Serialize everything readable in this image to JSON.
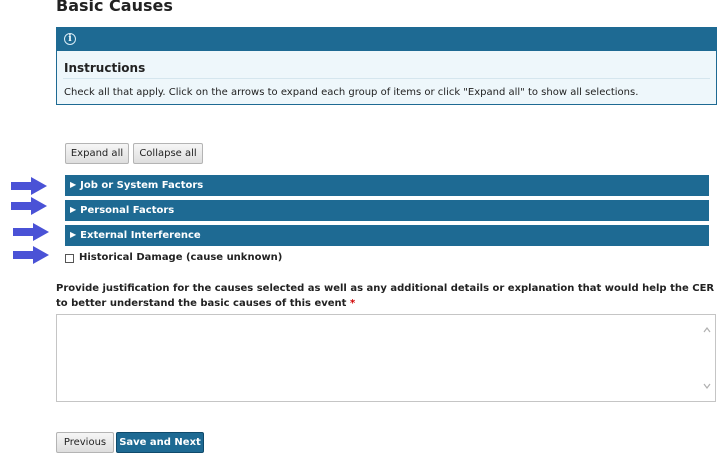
{
  "page": {
    "title": "Basic Causes"
  },
  "instructions": {
    "icon": "info-icon",
    "heading": "Instructions",
    "text": "Check all that apply. Click on the arrows to expand each group of items or click \"Expand all\" to show all selections."
  },
  "toolbar": {
    "expand_all": "Expand all",
    "collapse_all": "Collapse all"
  },
  "groups": [
    {
      "label": "Job or System Factors",
      "icon": "triangle-right-icon"
    },
    {
      "label": "Personal Factors",
      "icon": "triangle-right-icon"
    },
    {
      "label": "External Interference",
      "icon": "triangle-right-icon"
    }
  ],
  "checkbox": {
    "label": "Historical Damage (cause unknown)",
    "checked": false
  },
  "justification": {
    "prompt": "Provide justification for the causes selected as well as any additional details or explanation that would help the CER to better understand the basic causes of this event",
    "required_mark": "*",
    "value": ""
  },
  "footer": {
    "previous": "Previous",
    "save_next": "Save and Next"
  },
  "colors": {
    "accent": "#1e6a93",
    "annotation_arrow": "#4a52d6",
    "required": "#d00000"
  }
}
